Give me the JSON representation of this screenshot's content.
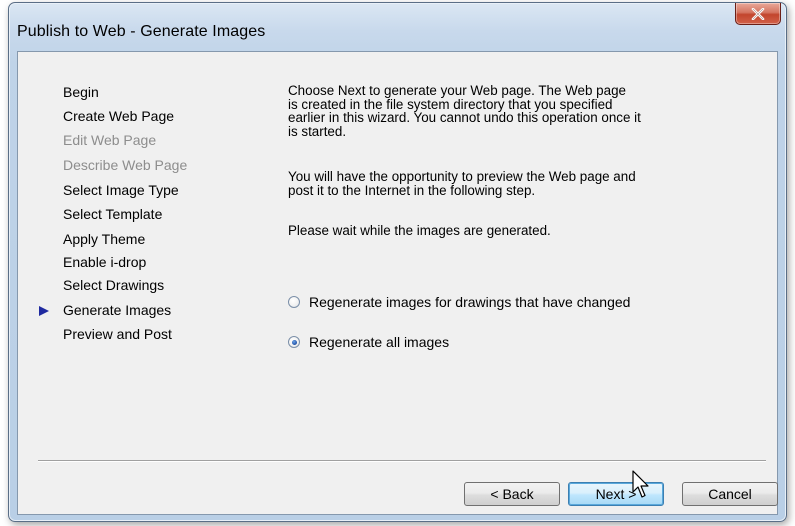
{
  "window": {
    "title": "Publish to Web - Generate Images",
    "close_symbol": "x"
  },
  "steps": [
    {
      "label": "Begin",
      "state": "enabled"
    },
    {
      "label": "Create Web Page",
      "state": "enabled"
    },
    {
      "label": "Edit Web Page",
      "state": "disabled"
    },
    {
      "label": "Describe Web Page",
      "state": "disabled"
    },
    {
      "label": "Select Image Type",
      "state": "enabled"
    },
    {
      "label": "Select Template",
      "state": "enabled"
    },
    {
      "label": "Apply Theme",
      "state": "enabled"
    },
    {
      "label": "Enable i-drop",
      "state": "enabled"
    },
    {
      "label": "Select Drawings",
      "state": "enabled"
    },
    {
      "label": "Generate Images",
      "state": "current"
    },
    {
      "label": "Preview and Post",
      "state": "enabled"
    }
  ],
  "content": {
    "paragraph1_line1": "Choose Next to generate your Web page.  The Web page",
    "paragraph1_line2": "is created in the file system directory that you specified",
    "paragraph1_line3": "earlier in this wizard.  You cannot undo this operation once it",
    "paragraph1_line4": "is started.",
    "paragraph2_line1": "You will have the opportunity to preview the Web page and",
    "paragraph2_line2": "post it to the Internet in the following step.",
    "paragraph3": "Please wait while the images are generated."
  },
  "options": {
    "regenerate_changed_label": "Regenerate images for drawings that have changed",
    "regenerate_changed_checked": false,
    "regenerate_all_label": "Regenerate all images",
    "regenerate_all_checked": true
  },
  "buttons": {
    "back_label": "< Back",
    "next_label": "Next >",
    "cancel_label": "Cancel"
  },
  "colors": {
    "current_step_arrow": "#1f2aa0",
    "close_button": "#c2452d",
    "disabled_text": "#8d8d8d"
  },
  "icons": {
    "close": "close-icon",
    "current_step": "current-step-arrow-icon",
    "cursor": "mouse-pointer-icon"
  }
}
